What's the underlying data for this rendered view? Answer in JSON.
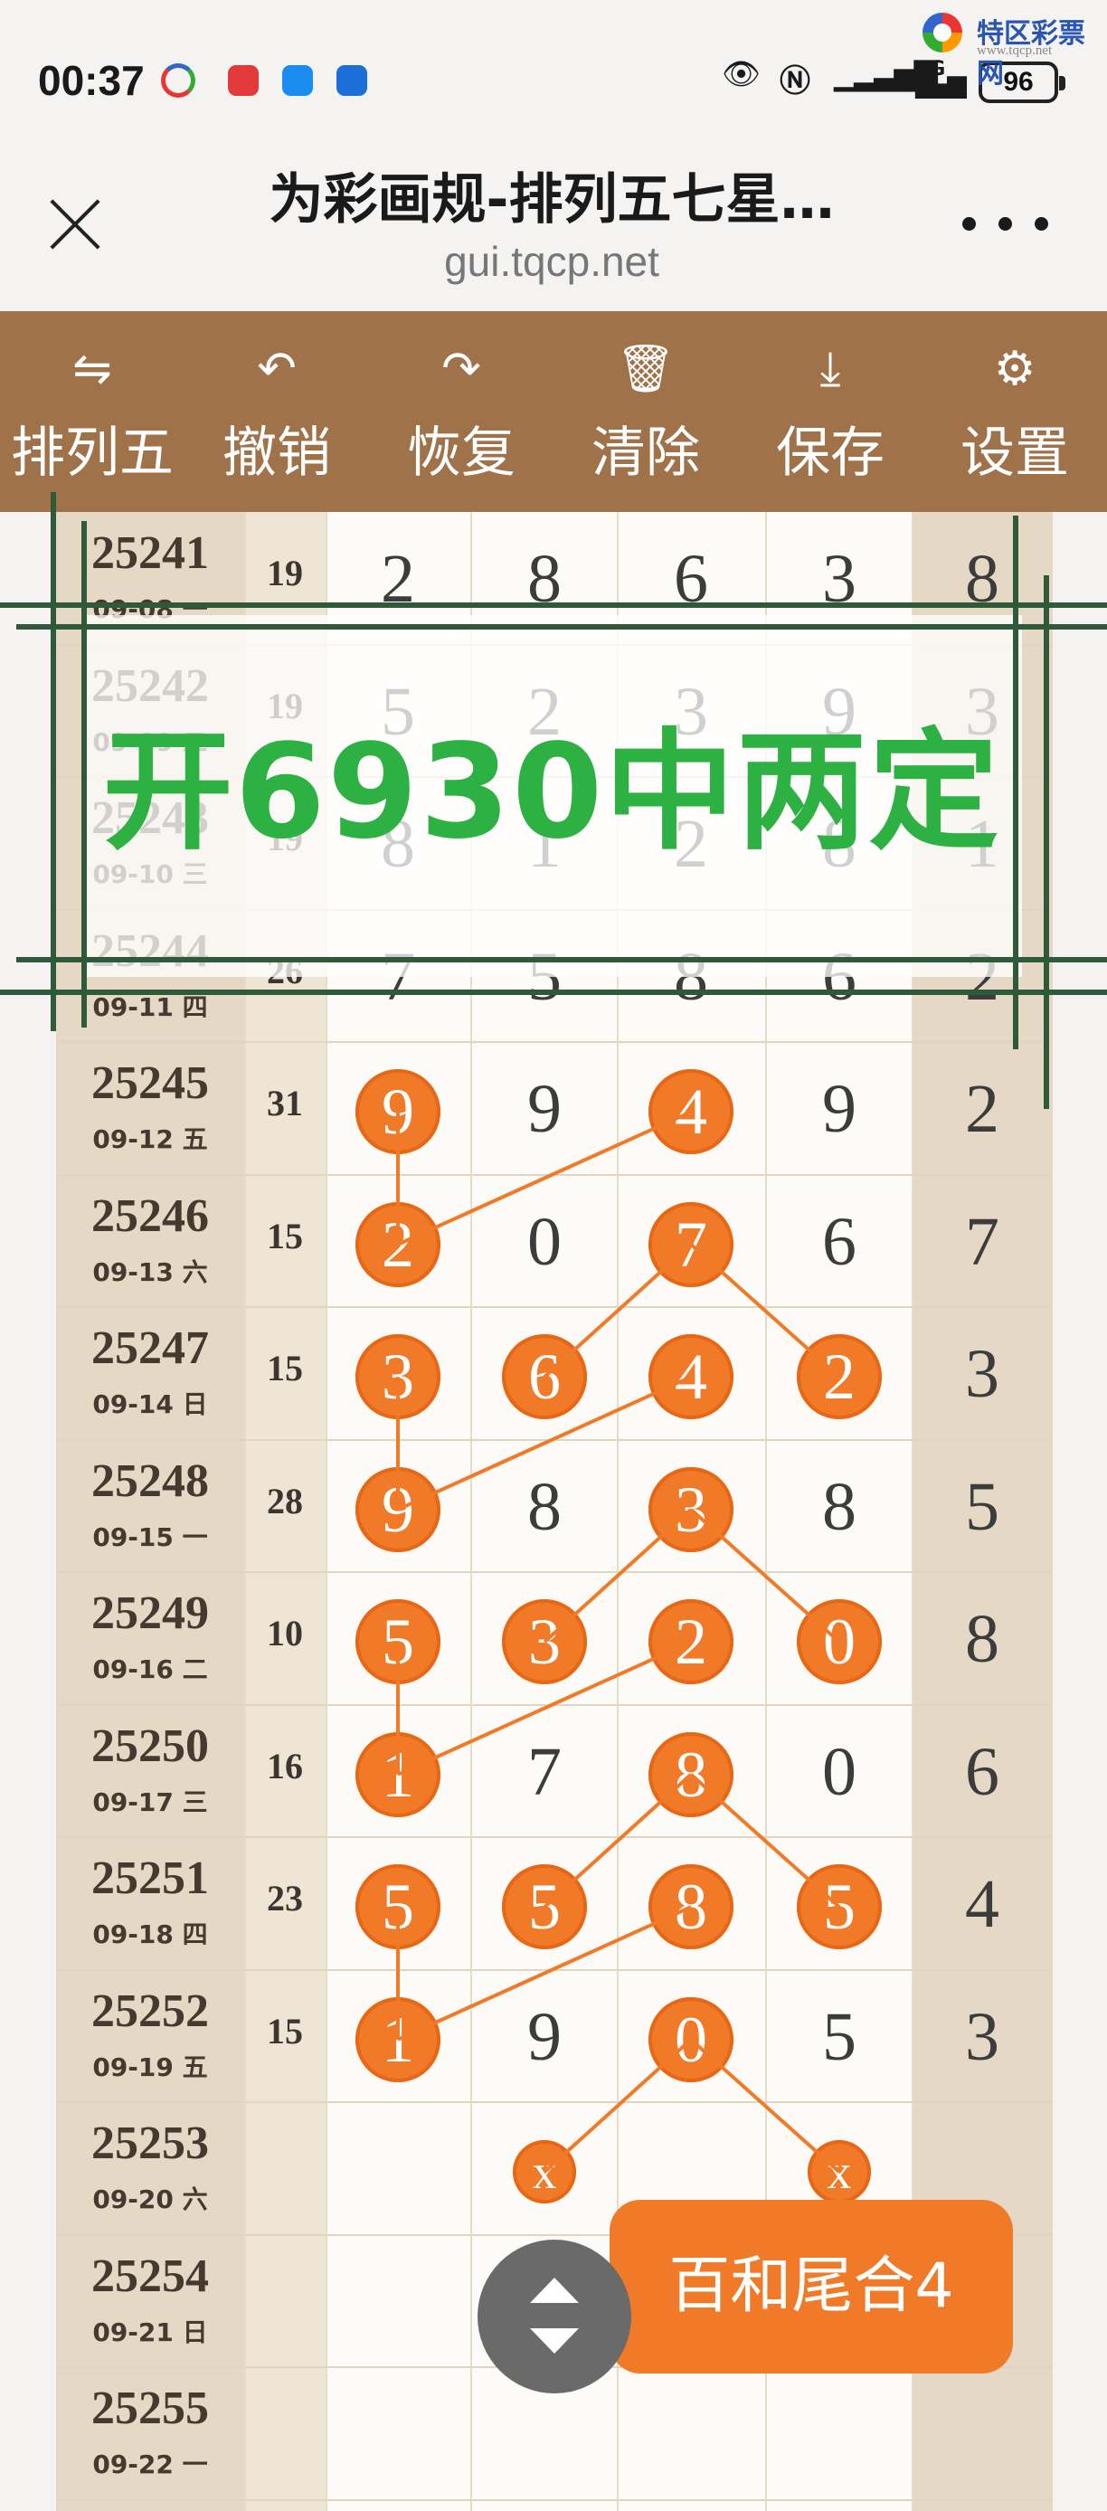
{
  "status_bar": {
    "time": "00:37",
    "network": "4G",
    "battery": "96",
    "icons": [
      "app-s-icon",
      "red-app-icon",
      "blue-app-icon",
      "blue-app2-icon",
      "eye-icon",
      "nfc-icon",
      "signal-icon",
      "wifi-icon",
      "battery-icon"
    ],
    "app_colors": [
      "#e23a3a",
      "#1a8cf0",
      "#1c6fd8"
    ]
  },
  "watermark": {
    "name": "特区彩票网",
    "url": "www.tqcp.net"
  },
  "header": {
    "title": "为彩画规-排列五七星…",
    "url": "gui.tqcp.net"
  },
  "toolbar": {
    "background": "#a0724a",
    "items": [
      {
        "label": "排列五",
        "icon": "swap-icon",
        "glyph": "⇋"
      },
      {
        "label": "撤销",
        "icon": "undo-icon",
        "glyph": "↶"
      },
      {
        "label": "恢复",
        "icon": "redo-icon",
        "glyph": "↷"
      },
      {
        "label": "清除",
        "icon": "trash-icon",
        "glyph": "🗑"
      },
      {
        "label": "保存",
        "icon": "download-icon",
        "glyph": "⤓"
      },
      {
        "label": "设置",
        "icon": "gear-icon",
        "glyph": "⚙"
      }
    ]
  },
  "grid": {
    "ball_color": "#f07a28",
    "rows": [
      {
        "no": "25241",
        "date": "09-08 一",
        "sum": "19",
        "digits": [
          "2",
          "8",
          "6",
          "3",
          "8"
        ],
        "marked": []
      },
      {
        "no": "25242",
        "date": "09-09 二",
        "sum": "19",
        "digits": [
          "5",
          "2",
          "3",
          "9",
          "3"
        ],
        "marked": []
      },
      {
        "no": "25243",
        "date": "09-10 三",
        "sum": "19",
        "digits": [
          "8",
          "1",
          "2",
          "8",
          "1"
        ],
        "marked": []
      },
      {
        "no": "25244",
        "date": "09-11 四",
        "sum": "26",
        "digits": [
          "7",
          "5",
          "8",
          "6",
          "2"
        ],
        "marked": []
      },
      {
        "no": "25245",
        "date": "09-12 五",
        "sum": "31",
        "digits": [
          "9",
          "9",
          "4",
          "9",
          "2"
        ],
        "marked": [
          0,
          2
        ]
      },
      {
        "no": "25246",
        "date": "09-13 六",
        "sum": "15",
        "digits": [
          "2",
          "0",
          "7",
          "6",
          "7"
        ],
        "marked": [
          0,
          2
        ]
      },
      {
        "no": "25247",
        "date": "09-14 日",
        "sum": "15",
        "digits": [
          "3",
          "6",
          "4",
          "2",
          "3"
        ],
        "marked": [
          0,
          1,
          2,
          3
        ]
      },
      {
        "no": "25248",
        "date": "09-15 一",
        "sum": "28",
        "digits": [
          "9",
          "8",
          "3",
          "8",
          "5"
        ],
        "marked": [
          0,
          2
        ]
      },
      {
        "no": "25249",
        "date": "09-16 二",
        "sum": "10",
        "digits": [
          "5",
          "3",
          "2",
          "0",
          "8"
        ],
        "marked": [
          0,
          1,
          2,
          3
        ]
      },
      {
        "no": "25250",
        "date": "09-17 三",
        "sum": "16",
        "digits": [
          "1",
          "7",
          "8",
          "0",
          "6"
        ],
        "marked": [
          0,
          2
        ]
      },
      {
        "no": "25251",
        "date": "09-18 四",
        "sum": "23",
        "digits": [
          "5",
          "5",
          "8",
          "5",
          "4"
        ],
        "marked": [
          0,
          1,
          2,
          3
        ]
      },
      {
        "no": "25252",
        "date": "09-19 五",
        "sum": "15",
        "digits": [
          "1",
          "9",
          "0",
          "5",
          "3"
        ],
        "marked": [
          0,
          2
        ]
      },
      {
        "no": "25253",
        "date": "09-20 六",
        "sum": "",
        "digits": [
          "",
          "x",
          "",
          "x",
          ""
        ],
        "marked": [
          1,
          3
        ]
      },
      {
        "no": "25254",
        "date": "09-21 日",
        "sum": "",
        "digits": [
          "",
          "",
          "",
          "",
          ""
        ],
        "marked": []
      },
      {
        "no": "25255",
        "date": "09-22 一",
        "sum": "",
        "digits": [
          "",
          "",
          "",
          "",
          ""
        ],
        "marked": []
      }
    ],
    "connections": [
      {
        "from": [
          4,
          0
        ],
        "to": [
          5,
          0
        ]
      },
      {
        "from": [
          4,
          2
        ],
        "to": [
          5,
          0
        ]
      },
      {
        "from": [
          5,
          2
        ],
        "to": [
          6,
          1
        ]
      },
      {
        "from": [
          5,
          2
        ],
        "to": [
          6,
          3
        ]
      },
      {
        "from": [
          6,
          0
        ],
        "to": [
          7,
          0
        ]
      },
      {
        "from": [
          6,
          2
        ],
        "to": [
          7,
          0
        ]
      },
      {
        "from": [
          7,
          2
        ],
        "to": [
          8,
          1
        ]
      },
      {
        "from": [
          7,
          2
        ],
        "to": [
          8,
          3
        ]
      },
      {
        "from": [
          8,
          0
        ],
        "to": [
          9,
          0
        ]
      },
      {
        "from": [
          8,
          2
        ],
        "to": [
          9,
          0
        ]
      },
      {
        "from": [
          9,
          2
        ],
        "to": [
          10,
          1
        ]
      },
      {
        "from": [
          9,
          2
        ],
        "to": [
          10,
          3
        ]
      },
      {
        "from": [
          10,
          0
        ],
        "to": [
          11,
          0
        ]
      },
      {
        "from": [
          10,
          2
        ],
        "to": [
          11,
          0
        ]
      },
      {
        "from": [
          11,
          2
        ],
        "to": [
          12,
          1
        ]
      },
      {
        "from": [
          11,
          2
        ],
        "to": [
          12,
          3
        ]
      }
    ]
  },
  "overlay": {
    "banner_text": "开6930中两定",
    "banner_color": "#2db143"
  },
  "float_button": {
    "label": "百和尾合4"
  },
  "scroll_button": {
    "icon": "scroll-updown-icon"
  }
}
